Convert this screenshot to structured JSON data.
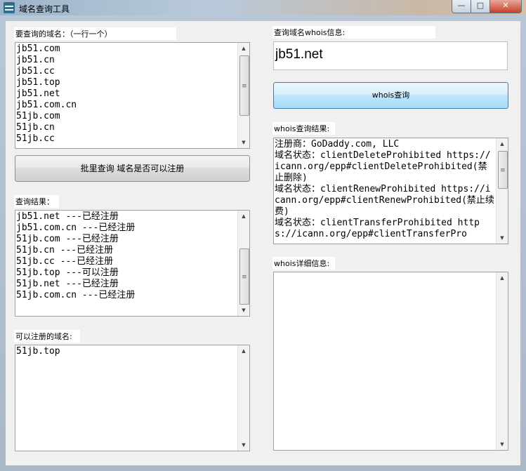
{
  "window": {
    "title": "域名查询工具",
    "controls": {
      "minimize": "—",
      "maximize": "□",
      "close": "✕"
    }
  },
  "left": {
    "domains_label": "要查询的域名：（一行一个）",
    "domains": [
      "jb51.com",
      "jb51.cn",
      "jb51.cc",
      "jb51.top",
      "jb51.net",
      "jb51.com.cn",
      "51jb.com",
      "51jb.cn",
      "51jb.cc"
    ],
    "batch_button": "批里查询 域名是否可以注册",
    "results_label": "查询结果：",
    "results": [
      "jb51.net ---已经注册",
      "jb51.com.cn ---已经注册",
      "51jb.com ---已经注册",
      "51jb.cn ---已经注册",
      "51jb.cc ---已经注册",
      "51jb.top ---可以注册",
      "51jb.net ---已经注册",
      "51jb.com.cn ---已经注册"
    ],
    "available_label": "可以注册的域名:",
    "available": [
      "51jb.top"
    ]
  },
  "right": {
    "whois_domain_label": "查询域名whois信息:",
    "whois_domain_value": "jb51.net",
    "whois_button": "whois查询",
    "whois_result_label": "whois查询结果:",
    "whois_result_lines": [
      "注册商：GoDaddy.com, LLC",
      "域名状态：clientDeleteProhibited https://icann.org/epp#clientDeleteProhibited(禁止删除)",
      "域名状态：clientRenewProhibited https://icann.org/epp#clientRenewProhibited(禁止续费)",
      "域名状态：clientTransferProhibited https://icann.org/epp#clientTransferPro"
    ],
    "whois_detail_label": "whois详细信息:",
    "whois_detail_text": ""
  },
  "colors": {
    "title_gradient": "#9fb5cb",
    "blue_button": "#bee6fd",
    "window_bg": "#f0f0f0"
  }
}
